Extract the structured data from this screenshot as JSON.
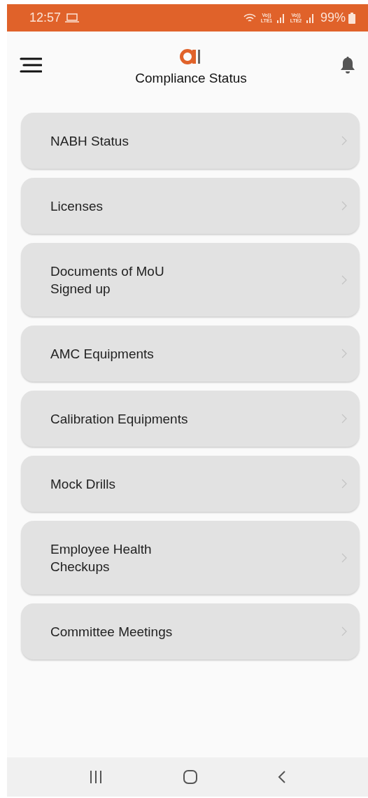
{
  "status_bar": {
    "time": "12:57",
    "sim_1": "Vo)) LTE1",
    "sim_2": "Vo)) LTE2",
    "battery": "99%"
  },
  "header": {
    "title": "Compliance Status"
  },
  "menu_items": [
    {
      "label": "NABH Status"
    },
    {
      "label": "Licenses"
    },
    {
      "label": "Documents of MoU\nSigned up"
    },
    {
      "label": "AMC Equipments"
    },
    {
      "label": "Calibration Equipments"
    },
    {
      "label": "Mock Drills"
    },
    {
      "label": "Employee Health\nCheckups"
    },
    {
      "label": "Committee Meetings"
    }
  ]
}
